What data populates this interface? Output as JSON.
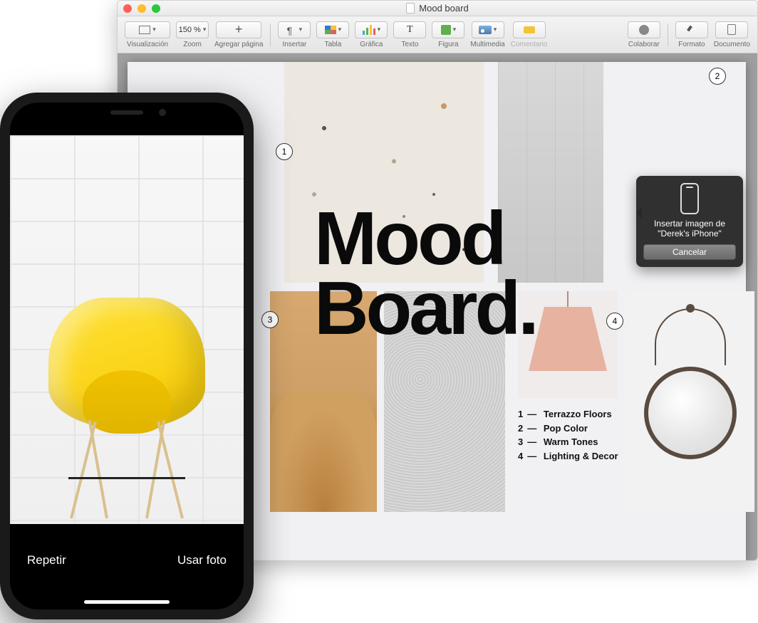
{
  "window": {
    "title": "Mood board"
  },
  "toolbar": {
    "view": "Visualización",
    "zoom_label": "Zoom",
    "zoom_value": "150 %",
    "add_page": "Agregar página",
    "insert": "Insertar",
    "table": "Tabla",
    "chart": "Gráfica",
    "text": "Texto",
    "shape": "Figura",
    "media": "Multimedia",
    "comment": "Comentario",
    "collaborate": "Colaborar",
    "format": "Formato",
    "document": "Documento"
  },
  "document": {
    "headline_l1": "Mood",
    "headline_l2": "Board.",
    "legend": [
      {
        "n": "1",
        "label": "Terrazzo Floors"
      },
      {
        "n": "2",
        "label": "Pop Color"
      },
      {
        "n": "3",
        "label": "Warm Tones"
      },
      {
        "n": "4",
        "label": "Lighting & Decor"
      }
    ],
    "callouts": {
      "c1": "1",
      "c2": "2",
      "c3": "3",
      "c4": "4"
    }
  },
  "popover": {
    "line1": "Insertar imagen de",
    "line2": "\"Derek's iPhone\"",
    "cancel": "Cancelar"
  },
  "iphone": {
    "retake": "Repetir",
    "use_photo": "Usar foto"
  }
}
